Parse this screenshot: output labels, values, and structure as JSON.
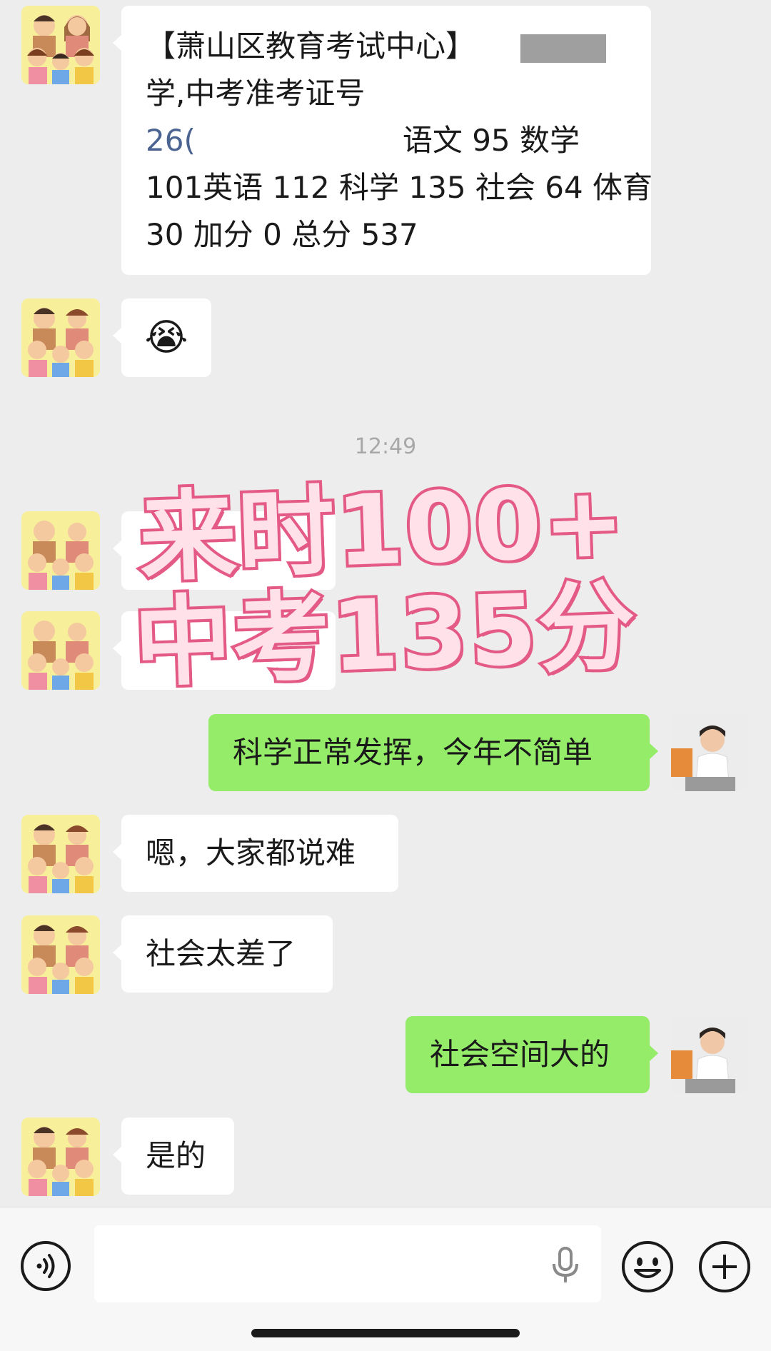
{
  "messages": {
    "m1_line1": "【萧山区教育考试中心】",
    "m1_line1b": "",
    "m1_line2": "学,中考准考证号",
    "m1_line3_prefix": "26(",
    "m1_line3_suffix": "语文 95 数学",
    "m1_line4": "101英语 112 科学 135 社会 64 体育",
    "m1_line5": "30 加分 0 总分 537",
    "m2_emoji": "😭",
    "time": "12:49",
    "m5": "科学正常发挥，今年不简单",
    "m6": "嗯，大家都说难",
    "m7": "社会太差了",
    "m8": "社会空间大的",
    "m9": "是的"
  },
  "overlay": {
    "line1": "来时100+",
    "line2": "中考135分"
  },
  "icons": [
    "voice-toggle-icon",
    "microphone-icon",
    "emoji-icon",
    "plus-icon"
  ],
  "colors": {
    "bubble_left": "#ffffff",
    "bubble_right": "#95ec69",
    "overlay_stroke": "#e45b86"
  }
}
